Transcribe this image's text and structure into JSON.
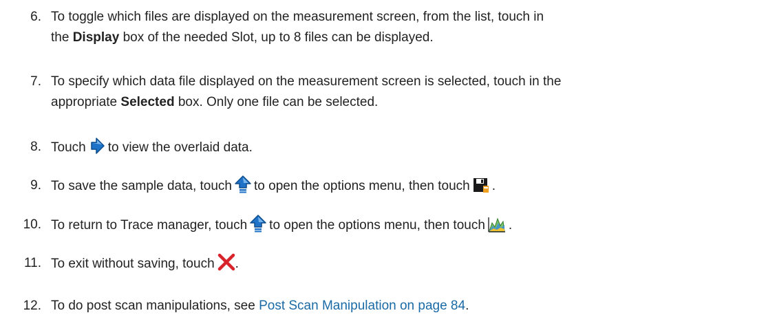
{
  "steps": [
    {
      "number": "6.",
      "line1_pre": "To toggle which files are displayed on the measurement screen, from the list, touch in",
      "line2_pre": "the ",
      "line2_bold": "Display",
      "line2_post": " box of the needed Slot, up to 8 files can be displayed."
    },
    {
      "number": "7.",
      "line1_pre": "To specify which data file displayed on the measurement screen is selected, touch in the",
      "line2_pre": "appropriate ",
      "line2_bold": "Selected",
      "line2_post": " box. Only one file can be selected."
    },
    {
      "number": "8.",
      "pre": "Touch",
      "icon": "next-arrow-icon",
      "post": "to view the overlaid data."
    },
    {
      "number": "9.",
      "pre": "To save the sample data, touch",
      "icon1": "up-arrow-icon",
      "mid": "to open the options menu, then touch",
      "icon2": "save-icon",
      "post": "."
    },
    {
      "number": "10.",
      "pre": "To return to Trace manager, touch",
      "icon1": "up-arrow-icon",
      "mid": "to open the options menu, then touch",
      "icon2": "trace-manager-icon",
      "post": "."
    },
    {
      "number": "11.",
      "pre": "To exit without saving, touch",
      "icon": "close-icon",
      "post": "."
    },
    {
      "number": "12.",
      "pre": "To do post scan manipulations, see ",
      "link": "Post Scan Manipulation on page 84",
      "post": "."
    }
  ],
  "colors": {
    "text": "#222222",
    "link": "#1a6aa6",
    "arrow_blue": "#1e73c8",
    "close_red": "#d8232a"
  }
}
